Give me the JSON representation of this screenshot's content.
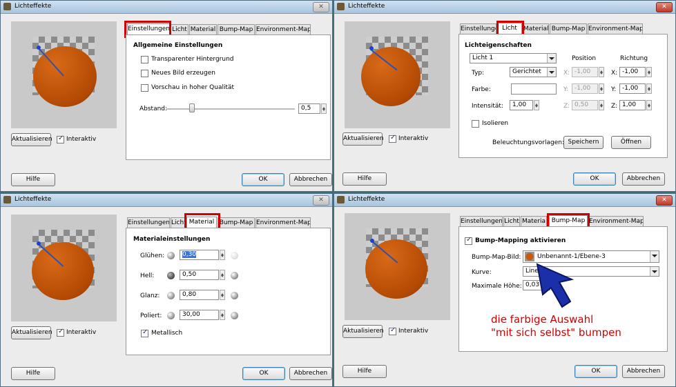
{
  "windows": [
    {
      "title": "Lichteffekte",
      "tabs": [
        "Einstellungen",
        "Licht",
        "Material",
        "Bump-Map",
        "Environment-Map"
      ],
      "active_tab": 0,
      "refresh_label": "Aktualisieren",
      "interactive_label": "Interaktiv",
      "help_label": "Hilfe",
      "ok_label": "OK",
      "cancel_label": "Abbrechen",
      "settings": {
        "heading": "Allgemeine Einstellungen",
        "transparent_bg": "Transparenter Hintergrund",
        "new_image": "Neues Bild erzeugen",
        "hq_preview": "Vorschau in hoher Qualität",
        "distance_label": "Abstand:",
        "distance_value": "0,5",
        "distance_fraction": 0.2
      }
    },
    {
      "title": "Lichteffekte",
      "tabs": [
        "Einstellungen",
        "Licht",
        "Material",
        "Bump-Map",
        "Environment-Map"
      ],
      "active_tab": 1,
      "refresh_label": "Aktualisieren",
      "interactive_label": "Interaktiv",
      "help_label": "Hilfe",
      "ok_label": "OK",
      "cancel_label": "Abbrechen",
      "light": {
        "heading": "Lichteigenschaften",
        "light_select": "Licht 1",
        "position_label": "Position",
        "direction_label": "Richtung",
        "type_label": "Typ:",
        "type_value": "Gerichtet",
        "color_label": "Farbe:",
        "intensity_label": "Intensität:",
        "intensity_value": "1,00",
        "x_label": "X:",
        "y_label": "Y:",
        "z_label": "Z:",
        "pos_x": "-1,00",
        "pos_y": "-1,00",
        "pos_z": "0,50",
        "dir_x": "-1,00",
        "dir_y": "-1,00",
        "dir_z": "1,00",
        "isolate_label": "Isolieren",
        "presets_label": "Beleuchtungsvorlagen:",
        "save_label": "Speichern",
        "open_label": "Öffnen"
      }
    },
    {
      "title": "Lichteffekte",
      "tabs": [
        "Einstellungen",
        "Licht",
        "Material",
        "Bump-Map",
        "Environment-Map"
      ],
      "active_tab": 2,
      "refresh_label": "Aktualisieren",
      "interactive_label": "Interaktiv",
      "help_label": "Hilfe",
      "ok_label": "OK",
      "cancel_label": "Abbrechen",
      "material": {
        "heading": "Materialeinstellungen",
        "glow_label": "Glühen:",
        "glow_value": "0,30",
        "bright_label": "Hell:",
        "bright_value": "0,50",
        "gloss_label": "Glanz:",
        "gloss_value": "0,80",
        "polish_label": "Poliert:",
        "polish_value": "30,00",
        "metallic_label": "Metallisch"
      }
    },
    {
      "title": "Lichteffekte",
      "tabs": [
        "Einstellungen",
        "Licht",
        "Materia",
        "Bump-Map",
        "Environment-Map"
      ],
      "active_tab": 3,
      "refresh_label": "Aktualisieren",
      "interactive_label": "Interaktiv",
      "help_label": "Hilfe",
      "ok_label": "OK",
      "cancel_label": "Abbrechen",
      "bump": {
        "enable_label": "Bump-Mapping aktivieren",
        "image_label": "Bump-Map-Bild:",
        "image_value": "Unbenannt-1/Ebene-3",
        "curve_label": "Kurve:",
        "curve_value": "Linear",
        "max_height_label": "Maximale Höhe:",
        "max_height_value": "0,03"
      }
    }
  ],
  "annotation": {
    "line1": "die farbige Auswahl",
    "line2": "\"mit sich selbst\" bumpen",
    "color": "#d00000"
  }
}
